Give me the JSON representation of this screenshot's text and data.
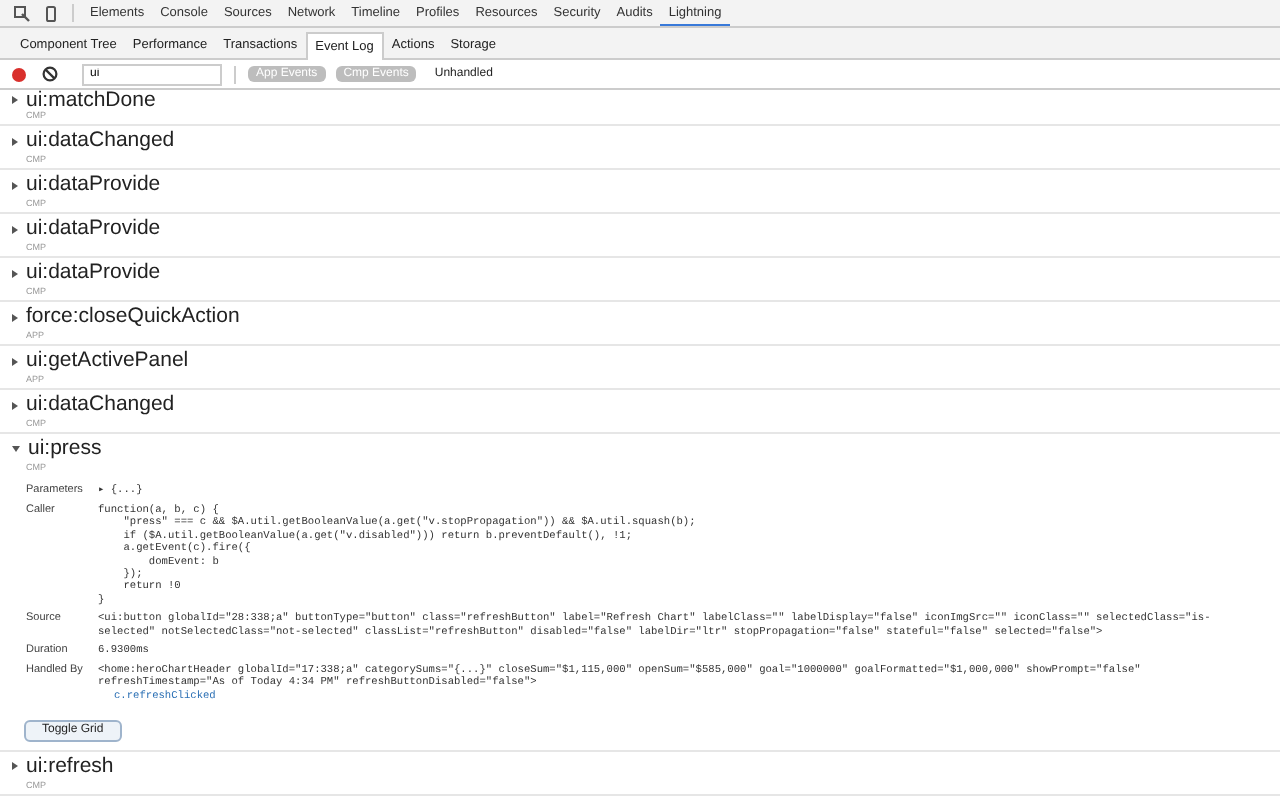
{
  "top_tabs": [
    {
      "label": "Elements",
      "selected": false
    },
    {
      "label": "Console",
      "selected": false
    },
    {
      "label": "Sources",
      "selected": false
    },
    {
      "label": "Network",
      "selected": false
    },
    {
      "label": "Timeline",
      "selected": false
    },
    {
      "label": "Profiles",
      "selected": false
    },
    {
      "label": "Resources",
      "selected": false
    },
    {
      "label": "Security",
      "selected": false
    },
    {
      "label": "Audits",
      "selected": false
    },
    {
      "label": "Lightning",
      "selected": true
    }
  ],
  "sub_tabs": [
    {
      "label": "Component Tree",
      "selected": false
    },
    {
      "label": "Performance",
      "selected": false
    },
    {
      "label": "Transactions",
      "selected": false
    },
    {
      "label": "Event Log",
      "selected": true
    },
    {
      "label": "Actions",
      "selected": false
    },
    {
      "label": "Storage",
      "selected": false
    }
  ],
  "toolbar": {
    "recording": true,
    "filter_value": "ui",
    "toggles": [
      {
        "label": "App Events",
        "on": true
      },
      {
        "label": "Cmp Events",
        "on": true
      },
      {
        "label": "Unhandled",
        "on": false
      }
    ]
  },
  "events": [
    {
      "name": "ui:matchDone",
      "type": "CMP",
      "expanded": false
    },
    {
      "name": "ui:dataChanged",
      "type": "CMP",
      "expanded": false
    },
    {
      "name": "ui:dataProvide",
      "type": "CMP",
      "expanded": false
    },
    {
      "name": "ui:dataProvide",
      "type": "CMP",
      "expanded": false
    },
    {
      "name": "ui:dataProvide",
      "type": "CMP",
      "expanded": false
    },
    {
      "name": "force:closeQuickAction",
      "type": "APP",
      "expanded": false
    },
    {
      "name": "ui:getActivePanel",
      "type": "APP",
      "expanded": false
    },
    {
      "name": "ui:dataChanged",
      "type": "CMP",
      "expanded": false
    },
    {
      "name": "ui:press",
      "type": "CMP",
      "expanded": true,
      "details": [
        {
          "label": "Parameters",
          "lines": [
            "▸ {...}"
          ]
        },
        {
          "label": "Caller",
          "lines": [
            "function(a, b, c) {",
            "    \"press\" === c && $A.util.getBooleanValue(a.get(\"v.stopPropagation\")) && $A.util.squash(b);",
            "    if ($A.util.getBooleanValue(a.get(\"v.disabled\"))) return b.preventDefault(), !1;",
            "    a.getEvent(c).fire({",
            "        domEvent: b",
            "    });",
            "    return !0",
            "}"
          ]
        },
        {
          "label": "Source",
          "lines": [
            "<ui:button globalId=\"28:338;a\" buttonType=\"button\" class=\"refreshButton\" label=\"Refresh Chart\" labelClass=\"\" labelDisplay=\"false\" iconImgSrc=\"\" iconClass=\"\" selectedClass=\"is-",
            "selected\" notSelectedClass=\"not-selected\" classList=\"refreshButton\" disabled=\"false\" labelDir=\"ltr\" stopPropagation=\"false\" stateful=\"false\" selected=\"false\">"
          ]
        },
        {
          "label": "Duration",
          "lines": [
            "6.9300ms"
          ]
        },
        {
          "label": "Handled By",
          "lines": [
            "<home:heroChartHeader globalId=\"17:338;a\" categorySums=\"{...}\" closeSum=\"$1,115,000\" openSum=\"$585,000\" goal=\"1000000\" goalFormatted=\"$1,000,000\" showPrompt=\"false\"",
            "refreshTimestamp=\"As of Today 4:34 PM\" refreshButtonDisabled=\"false\">"
          ],
          "handler": "c.refreshClicked"
        }
      ],
      "button": "Toggle Grid"
    },
    {
      "name": "ui:refresh",
      "type": "CMP",
      "expanded": false
    }
  ]
}
